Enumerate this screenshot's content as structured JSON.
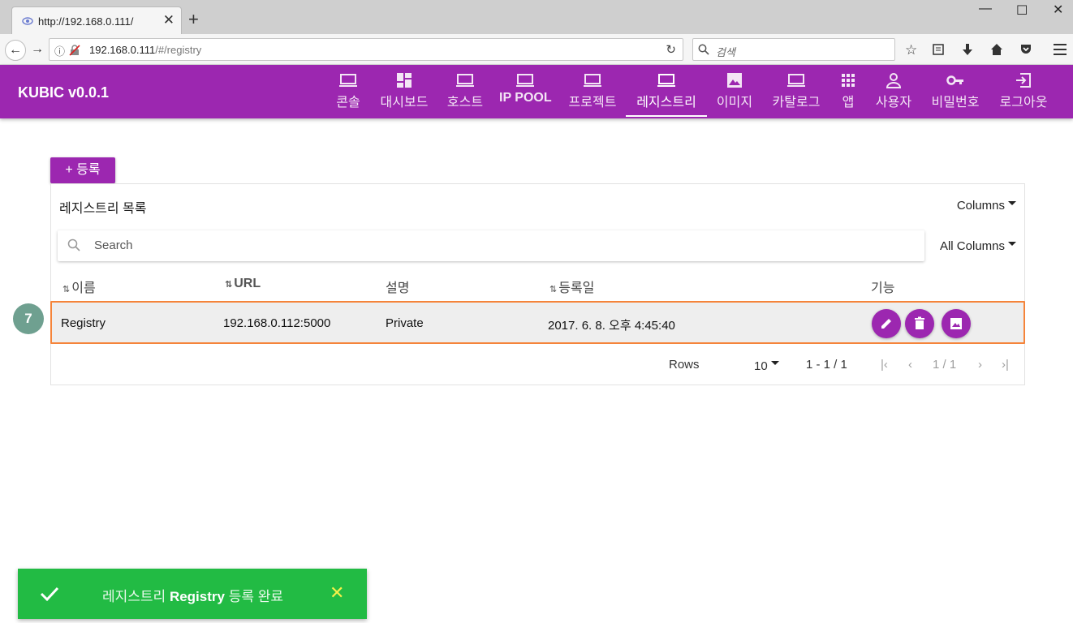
{
  "browser": {
    "tab_title": "http://192.168.0.111/",
    "url_host": "192.168.0.111",
    "url_path": "/#/registry",
    "search_placeholder": "검색"
  },
  "app": {
    "brand": "KUBIC v0.0.1",
    "menu": [
      {
        "label": "콘솔",
        "icon": "laptop-icon"
      },
      {
        "label": "대시보드",
        "icon": "dashboard-icon"
      },
      {
        "label": "호스트",
        "icon": "laptop-icon"
      },
      {
        "label": "IP POOL",
        "icon": "laptop-icon"
      },
      {
        "label": "프로젝트",
        "icon": "laptop-icon"
      },
      {
        "label": "레지스트리",
        "icon": "laptop-icon"
      },
      {
        "label": "이미지",
        "icon": "image-icon"
      },
      {
        "label": "카탈로그",
        "icon": "laptop-icon"
      },
      {
        "label": "앱",
        "icon": "apps-icon"
      },
      {
        "label": "사용자",
        "icon": "person-icon"
      },
      {
        "label": "비밀번호",
        "icon": "key-icon"
      },
      {
        "label": "로그아웃",
        "icon": "exit-icon"
      }
    ],
    "active_menu": "레지스트리",
    "accent_color": "#9c27b0"
  },
  "page": {
    "register_button": "+ 등록",
    "card_title": "레지스트리 목록",
    "columns_dropdown": "Columns",
    "search_placeholder": "Search",
    "all_columns_dropdown": "All Columns",
    "headers": [
      "이름",
      "URL",
      "설명",
      "등록일",
      "기능"
    ],
    "rows": [
      {
        "name": "Registry",
        "url": "192.168.0.112:5000",
        "desc": "Private",
        "date": "2017. 6. 8. 오후 4:45:40"
      }
    ],
    "footer": {
      "rows_label": "Rows",
      "rows_per_page": "10",
      "range": "1 - 1 / 1",
      "page": "1 / 1"
    },
    "step_badge": "7"
  },
  "toast": {
    "prefix": "레지스트리",
    "name": "Registry",
    "suffix": "등록 완료",
    "color": "#22bb44"
  }
}
